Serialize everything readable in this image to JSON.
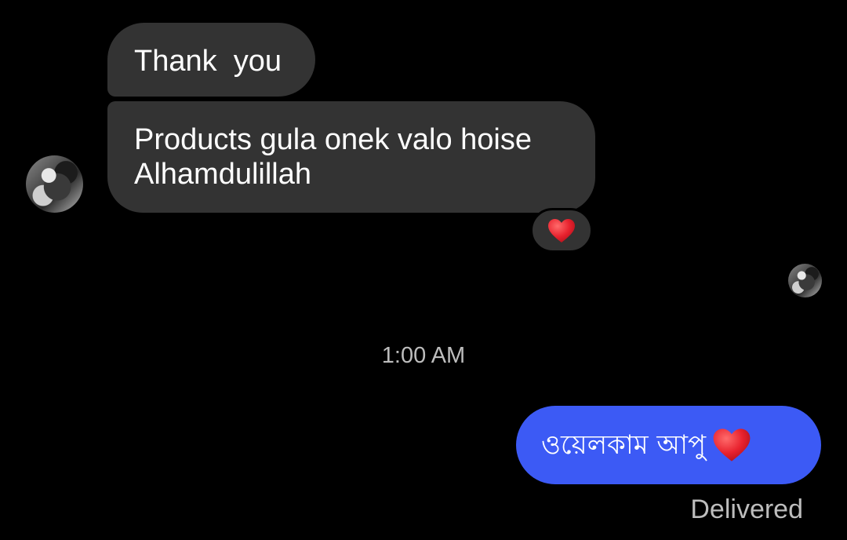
{
  "conversation": {
    "messages": [
      {
        "sender": "contact",
        "text": "Thank  you"
      },
      {
        "sender": "contact",
        "text_line1": "Products gula onek valo hoise",
        "text_line2": "Alhamdulillah",
        "reaction_icon": "red-heart-icon"
      },
      {
        "sender": "me",
        "text": "ওয়েলকাম আপু",
        "emoji_icon": "red-heart-icon"
      }
    ],
    "timestamp": "1:00 AM",
    "status": "Delivered"
  },
  "colors": {
    "background": "#000000",
    "incoming_bubble": "#333333",
    "outgoing_bubble": "#3c5af5",
    "heart": "#e8222e",
    "muted_text": "#bdbdbd"
  }
}
